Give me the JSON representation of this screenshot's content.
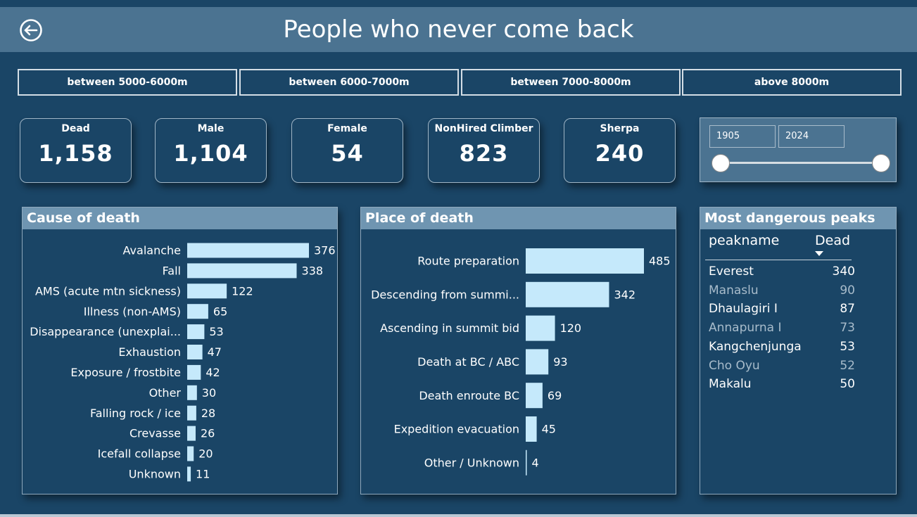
{
  "header": {
    "title": "People who never come back",
    "back_icon": "back-arrow-icon"
  },
  "altitude_buttons": [
    {
      "label": "between 5000-6000m"
    },
    {
      "label": "between 6000-7000m"
    },
    {
      "label": "between 7000-8000m"
    },
    {
      "label": "above 8000m"
    }
  ],
  "kpis": [
    {
      "label": "Dead",
      "value": "1,158"
    },
    {
      "label": "Male",
      "value": "1,104"
    },
    {
      "label": "Female",
      "value": "54"
    },
    {
      "label": "NonHired Climber",
      "value": "823"
    },
    {
      "label": "Sherpa",
      "value": "240"
    }
  ],
  "year_slicer": {
    "start": "1905",
    "end": "2024"
  },
  "colors": {
    "background": "#1a4566",
    "header": "#4b7391",
    "panel_title": "#6f95b1",
    "bar": "#c5e9fb",
    "muted_text": "#a8bccb"
  },
  "cause_panel": {
    "title": "Cause of death",
    "chart_data": {
      "type": "bar",
      "orientation": "horizontal",
      "categories": [
        "Avalanche",
        "Fall",
        "AMS (acute mtn sickness)",
        "Illness (non-AMS)",
        "Disappearance (unexplai...",
        "Exhaustion",
        "Exposure / frostbite",
        "Other",
        "Falling rock / ice",
        "Crevasse",
        "Icefall collapse",
        "Unknown"
      ],
      "values": [
        376,
        338,
        122,
        65,
        53,
        47,
        42,
        30,
        28,
        26,
        20,
        11
      ]
    }
  },
  "place_panel": {
    "title": "Place of death",
    "chart_data": {
      "type": "bar",
      "orientation": "horizontal",
      "categories": [
        "Route preparation",
        "Descending from summi...",
        "Ascending in summit bid",
        "Death at BC / ABC",
        "Death enroute BC",
        "Expedition evacuation",
        "Other / Unknown"
      ],
      "values": [
        485,
        342,
        120,
        93,
        69,
        45,
        4
      ]
    }
  },
  "peaks_panel": {
    "title": "Most dangerous peaks",
    "col_name": "peakname",
    "col_value": "Dead",
    "rows": [
      {
        "name": "Everest",
        "value": "340",
        "muted": false
      },
      {
        "name": "Manaslu",
        "value": "90",
        "muted": true
      },
      {
        "name": "Dhaulagiri I",
        "value": "87",
        "muted": false
      },
      {
        "name": "Annapurna I",
        "value": "73",
        "muted": true
      },
      {
        "name": "Kangchenjunga",
        "value": "53",
        "muted": false
      },
      {
        "name": "Cho Oyu",
        "value": "52",
        "muted": true
      },
      {
        "name": "Makalu",
        "value": "50",
        "muted": false
      }
    ]
  }
}
